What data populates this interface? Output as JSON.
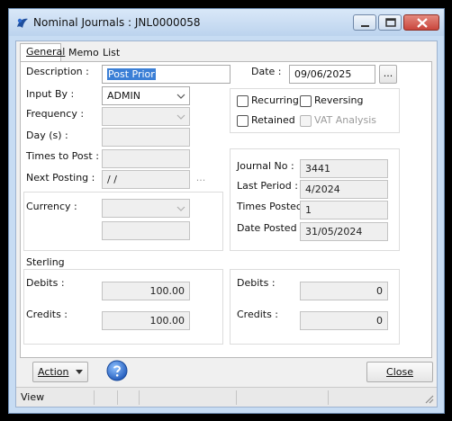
{
  "window": {
    "title": "Nominal Journals : JNL0000058"
  },
  "tabs": [
    {
      "label": "General",
      "key": "G"
    },
    {
      "label": "Memo",
      "key": "M"
    },
    {
      "label": "List",
      "key": "L"
    }
  ],
  "form": {
    "description_label": "Description :",
    "description_value": "Post Prior",
    "date_label": "Date :",
    "date_value": "09/06/2025",
    "date_button": "...",
    "input_by_label": "Input By :",
    "input_by_value": "ADMIN",
    "frequency_label": "Frequency :",
    "frequency_value": "",
    "days_label": "Day (s) :",
    "days_value": "",
    "times_to_post_label": "Times to Post :",
    "times_to_post_value": "",
    "next_posting_label": "Next Posting :",
    "next_posting_value": "/ /",
    "next_posting_button": "...",
    "currency_label": "Currency :",
    "currency_value": "",
    "currency_rate_value": ""
  },
  "checkboxes": {
    "recurring": {
      "label": "Recurring",
      "checked": false,
      "enabled": true
    },
    "reversing": {
      "label": "Reversing",
      "checked": false,
      "enabled": true
    },
    "retained": {
      "label": "Retained",
      "checked": false,
      "enabled": true
    },
    "vat_analysis": {
      "label": "VAT Analysis",
      "checked": false,
      "enabled": false
    }
  },
  "info": {
    "journal_no_label": "Journal No :",
    "journal_no_value": "3441",
    "last_period_label": "Last Period :",
    "last_period_value": "4/2024",
    "times_posted_label": "Times Posted :",
    "times_posted_value": "1",
    "date_posted_label": "Date Posted :",
    "date_posted_value": "31/05/2024"
  },
  "sterling": {
    "title": "Sterling",
    "debits_label": "Debits :",
    "debits_value": "100.00",
    "credits_label": "Credits :",
    "credits_value": "100.00"
  },
  "currency_totals": {
    "debits_label": "Debits :",
    "debits_value": "0",
    "credits_label": "Credits :",
    "credits_value": "0"
  },
  "buttons": {
    "action_label": "Action",
    "action_key": "A",
    "close_label": "Close",
    "close_key": "C"
  },
  "statusbar": {
    "text": "View"
  },
  "colors": {
    "selection": "#3b7fd6",
    "title_gradient_top": "#d9e8f8",
    "close_button": "#c9463d"
  }
}
